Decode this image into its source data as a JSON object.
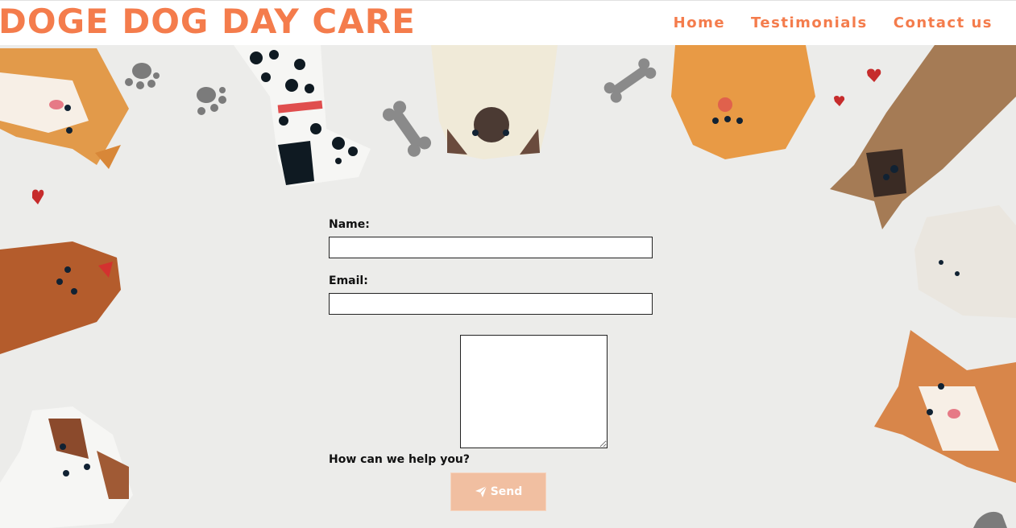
{
  "brand": {
    "title": "DOGE DOG DAY CARE"
  },
  "nav": {
    "items": [
      {
        "label": "Home"
      },
      {
        "label": "Testimonials"
      },
      {
        "label": "Contact us"
      }
    ]
  },
  "form": {
    "name_label": "Name:",
    "name_value": "",
    "email_label": "Email:",
    "email_value": "",
    "message_label": "How can we help you?",
    "message_value": "",
    "send_label": "Send"
  },
  "colors": {
    "accent": "#f47c4c",
    "button": "#f1bfa1",
    "background": "#ececea"
  },
  "icons": [
    "paper-plane-icon",
    "paw-icon",
    "bone-icon",
    "heart-icon"
  ]
}
